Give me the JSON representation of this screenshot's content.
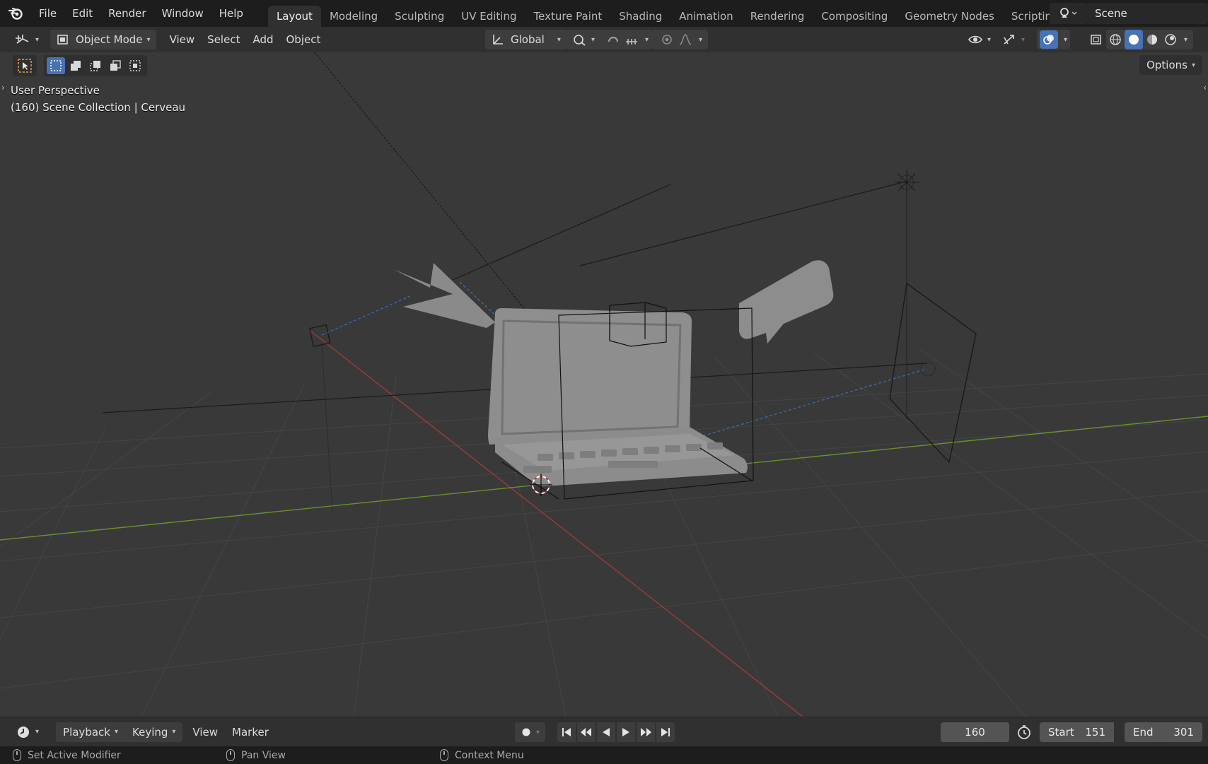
{
  "topbar": {
    "menus": [
      "File",
      "Edit",
      "Render",
      "Window",
      "Help"
    ],
    "workspaces": [
      "Layout",
      "Modeling",
      "Sculpting",
      "UV Editing",
      "Texture Paint",
      "Shading",
      "Animation",
      "Rendering",
      "Compositing",
      "Geometry Nodes",
      "Scripting"
    ],
    "active_workspace": "Layout",
    "add_workspace": "+",
    "scene_name": "Scene"
  },
  "header": {
    "mode": "Object Mode",
    "menus": [
      "View",
      "Select",
      "Add",
      "Object"
    ],
    "transform_orientation": "Global",
    "options": "Options"
  },
  "viewport": {
    "perspective": "User Perspective",
    "collection_info": "(160) Scene Collection | Cerveau"
  },
  "timeline": {
    "menus": [
      "Playback",
      "Keying",
      "View",
      "Marker"
    ],
    "current_frame": "160",
    "start_label": "Start",
    "start_value": "151",
    "end_label": "End",
    "end_value": "301"
  },
  "statusbar": {
    "left": "Set Active Modifier",
    "middle": "Pan View",
    "right": "Context Menu"
  },
  "colors": {
    "accent": "#4772b3",
    "x_axis": "#9a3b3b",
    "y_axis": "#6a8f2d",
    "viewport_bg": "#393939"
  }
}
